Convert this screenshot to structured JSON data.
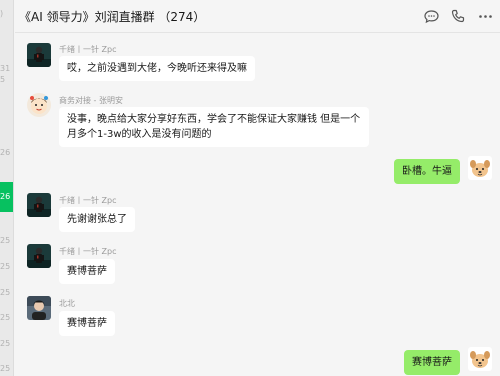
{
  "sidebar": {
    "fragments": [
      ")",
      "31",
      "5",
      "26",
      "26",
      "25",
      "25",
      "25",
      "25",
      "25",
      "25"
    ]
  },
  "header": {
    "title": "《AI 领导力》刘润直播群 （274）",
    "icons": [
      "chat-bubble-icon",
      "phone-icon",
      "more-icon"
    ]
  },
  "messages": [
    {
      "sender": "千绪丨一针 Zpc",
      "text": "哎，之前没遇到大佬，今晚听还来得及嘛",
      "outgoing": false,
      "avatar": "dark-figure-avatar"
    },
    {
      "sender": "商务对接 - 张明安",
      "text": "没事，晚点给大家分享好东西，学会了不能保证大家赚钱 但是一个月多个1-3w的收入是没有问题的",
      "outgoing": false,
      "avatar": "cartoon-face-avatar"
    },
    {
      "sender": "",
      "text": "卧槽。牛逼",
      "outgoing": true,
      "avatar": "cartoon-dog-avatar"
    },
    {
      "sender": "千绪丨一针 Zpc",
      "text": "先谢谢张总了",
      "outgoing": false,
      "avatar": "dark-figure-avatar"
    },
    {
      "sender": "千绪丨一针 Zpc",
      "text": "赛博菩萨",
      "outgoing": false,
      "avatar": "dark-figure-avatar"
    },
    {
      "sender": "北北",
      "text": "赛博菩萨",
      "outgoing": false,
      "avatar": "portrait-avatar"
    },
    {
      "sender": "",
      "text": "赛博菩萨",
      "outgoing": true,
      "avatar": "cartoon-dog-avatar"
    }
  ],
  "colors": {
    "accent": "#07c160",
    "outgoing_bubble": "#95ec69",
    "incoming_bubble": "#ffffff",
    "background": "#f5f5f5"
  }
}
